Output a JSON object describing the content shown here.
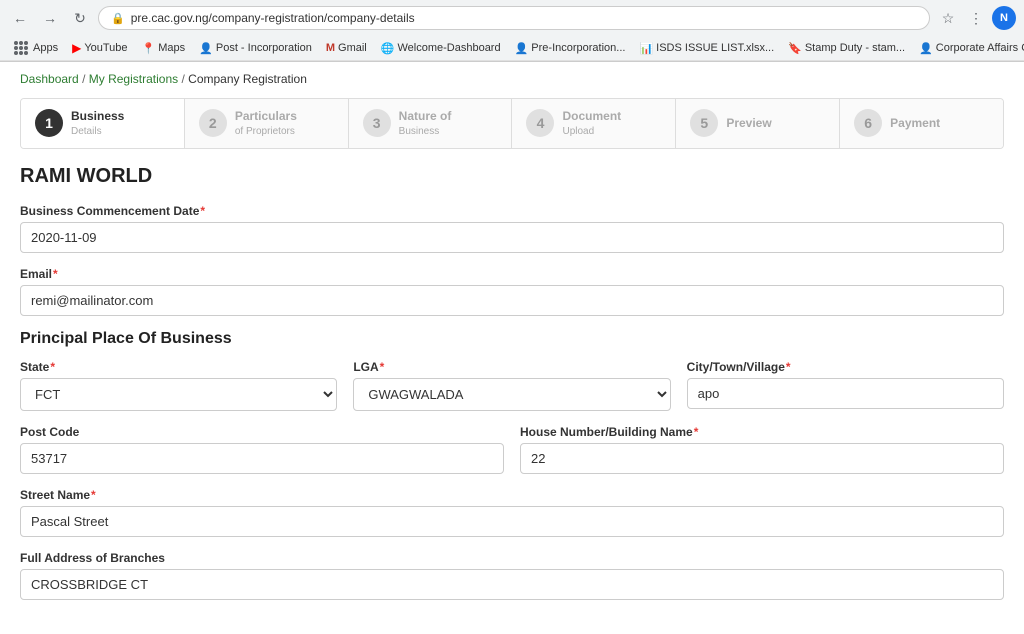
{
  "browser": {
    "back_label": "←",
    "forward_label": "→",
    "reload_label": "↻",
    "url": "pre.cac.gov.ng/company-registration/company-details",
    "star_icon": "☆",
    "search_icon": "🔍",
    "profile_initial": "N"
  },
  "bookmarks": {
    "apps_label": "Apps",
    "items": [
      {
        "id": "youtube",
        "label": "YouTube",
        "icon": "▶"
      },
      {
        "id": "maps",
        "label": "Maps",
        "icon": "📍"
      },
      {
        "id": "post-incorporation",
        "label": "Post - Incorporation",
        "icon": "👤"
      },
      {
        "id": "gmail",
        "label": "Gmail",
        "icon": "M"
      },
      {
        "id": "welcome-dashboard",
        "label": "Welcome-Dashboard",
        "icon": "🌐"
      },
      {
        "id": "pre-incorporation",
        "label": "Pre-Incorporation...",
        "icon": "👤"
      },
      {
        "id": "isds",
        "label": "ISDS ISSUE LIST.xlsx...",
        "icon": "📊"
      },
      {
        "id": "stamp-duty",
        "label": "Stamp Duty - stam...",
        "icon": "🔖"
      },
      {
        "id": "corporate",
        "label": "Corporate Affairs C...",
        "icon": "👤"
      }
    ]
  },
  "breadcrumb": {
    "dashboard_label": "Dashboard",
    "my_registrations_label": "My Registrations",
    "current_label": "Company Registration",
    "sep": "/"
  },
  "wizard": {
    "steps": [
      {
        "number": "1",
        "title": "Business",
        "subtitle": "Details",
        "active": true
      },
      {
        "number": "2",
        "title": "Particulars",
        "subtitle": "of Proprietors",
        "active": false
      },
      {
        "number": "3",
        "title": "Nature of",
        "subtitle": "Business",
        "active": false
      },
      {
        "number": "4",
        "title": "Document",
        "subtitle": "Upload",
        "active": false
      },
      {
        "number": "5",
        "title": "Preview",
        "subtitle": "",
        "active": false
      },
      {
        "number": "6",
        "title": "Payment",
        "subtitle": "",
        "active": false
      }
    ]
  },
  "form": {
    "company_name": "RAMI WORLD",
    "business_commencement_label": "Business Commencement Date",
    "business_commencement_value": "2020-11-09",
    "email_label": "Email",
    "email_value": "remi@mailinator.com",
    "principal_place_section": "Principal Place Of Business",
    "state_label": "State",
    "state_value": "FCT",
    "lga_label": "LGA",
    "lga_value": "GWAGWALADA",
    "city_label": "City/Town/Village",
    "city_value": "apo",
    "post_code_label": "Post Code",
    "post_code_value": "53717",
    "house_number_label": "House Number/Building Name",
    "house_number_value": "22",
    "street_name_label": "Street Name",
    "street_name_value": "Pascal Street",
    "full_address_label": "Full Address of Branches",
    "full_address_value": "CROSSBRIDGE CT",
    "required_marker": "*"
  }
}
